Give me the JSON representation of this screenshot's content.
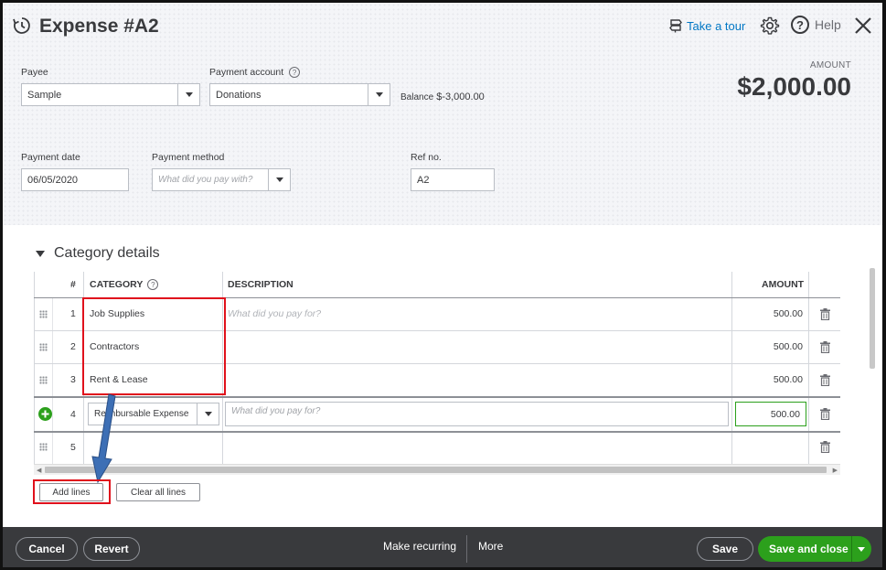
{
  "header": {
    "title": "Expense #A2",
    "tour_label": "Take a tour",
    "help_label": "Help"
  },
  "payee": {
    "label": "Payee",
    "value": "Sample"
  },
  "payment_account": {
    "label": "Payment account",
    "value": "Donations",
    "balance_label": "Balance",
    "balance_value": "$-3,000.00"
  },
  "amount": {
    "label": "AMOUNT",
    "value": "$2,000.00"
  },
  "payment_date": {
    "label": "Payment date",
    "value": "06/05/2020"
  },
  "payment_method": {
    "label": "Payment method",
    "placeholder": "What did you pay with?"
  },
  "ref_no": {
    "label": "Ref no.",
    "value": "A2"
  },
  "category_details": {
    "title": "Category details",
    "columns": {
      "num": "#",
      "category": "CATEGORY",
      "description": "DESCRIPTION",
      "amount": "AMOUNT"
    },
    "description_placeholder": "What did you pay for?",
    "rows": [
      {
        "num": "1",
        "category": "Job Supplies",
        "description": "What did you pay for?",
        "amount": "500.00"
      },
      {
        "num": "2",
        "category": "Contractors",
        "description": "",
        "amount": "500.00"
      },
      {
        "num": "3",
        "category": "Rent & Lease",
        "description": "",
        "amount": "500.00"
      },
      {
        "num": "4",
        "category": "Reimbursable Expense",
        "description": "What did you pay for?",
        "amount": "500.00"
      },
      {
        "num": "5",
        "category": "",
        "description": "",
        "amount": ""
      }
    ]
  },
  "actions": {
    "add_lines": "Add lines",
    "clear_all_lines": "Clear all lines"
  },
  "footer": {
    "cancel": "Cancel",
    "revert": "Revert",
    "make_recurring": "Make recurring",
    "more": "More",
    "save": "Save",
    "save_and_close": "Save and close"
  },
  "colors": {
    "accent_green": "#2ca01c",
    "link_blue": "#0077c5",
    "highlight_red": "#e0111c",
    "footer_bg": "#393a3d",
    "arrow_blue": "#3d6fb5"
  }
}
